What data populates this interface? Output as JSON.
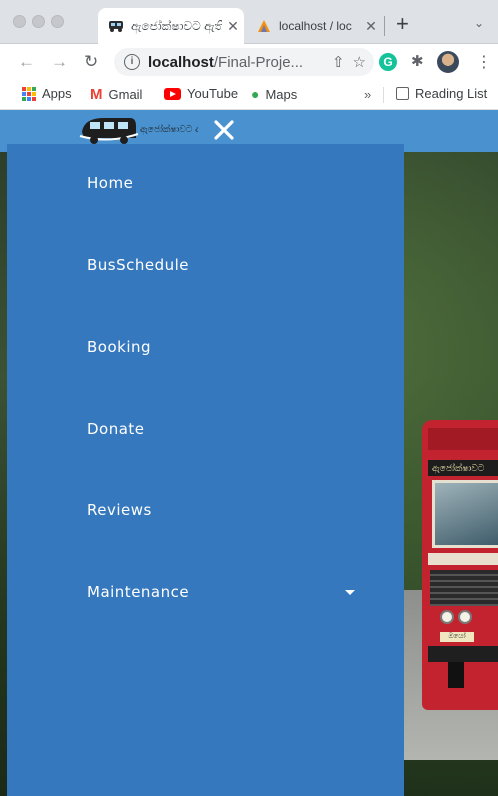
{
  "browser": {
    "tabs": [
      {
        "title": "ඇජෝක්ෂාවට ඇති",
        "active": true,
        "favicon": "bus-logo-icon"
      },
      {
        "title": "localhost / loc",
        "active": false,
        "favicon": "phpmyadmin-icon"
      }
    ],
    "new_tab_label": "+",
    "tab_menu_label": "⌄",
    "address": {
      "host": "localhost",
      "path": "/Final-Proje..."
    },
    "bookmarks": [
      {
        "label": "Apps",
        "icon": "apps-grid-icon"
      },
      {
        "label": "Gmail",
        "icon": "gmail-icon"
      },
      {
        "label": "YouTube",
        "icon": "youtube-icon"
      },
      {
        "label": "Maps",
        "icon": "maps-pin-icon"
      }
    ],
    "bookmarks_overflow": "»",
    "reading_list": "Reading List"
  },
  "header": {
    "brand_icon": "bus-logo-icon",
    "brand_text": "ඇජෝක්ෂාවට ඇති",
    "close_icon": "close-icon",
    "bar_color": "#4a92cf"
  },
  "drawer": {
    "color": "#3578bd",
    "items": [
      {
        "label": "Home"
      },
      {
        "label": "BusSchedule"
      },
      {
        "label": "Booking"
      },
      {
        "label": "Donate"
      },
      {
        "label": "Reviews"
      },
      {
        "label": "Maintenance",
        "has_dropdown": true
      }
    ]
  },
  "hero": {
    "bus_sign": "ඇජෝක්ෂාවට",
    "bus_plate": "ඔයෝ"
  }
}
